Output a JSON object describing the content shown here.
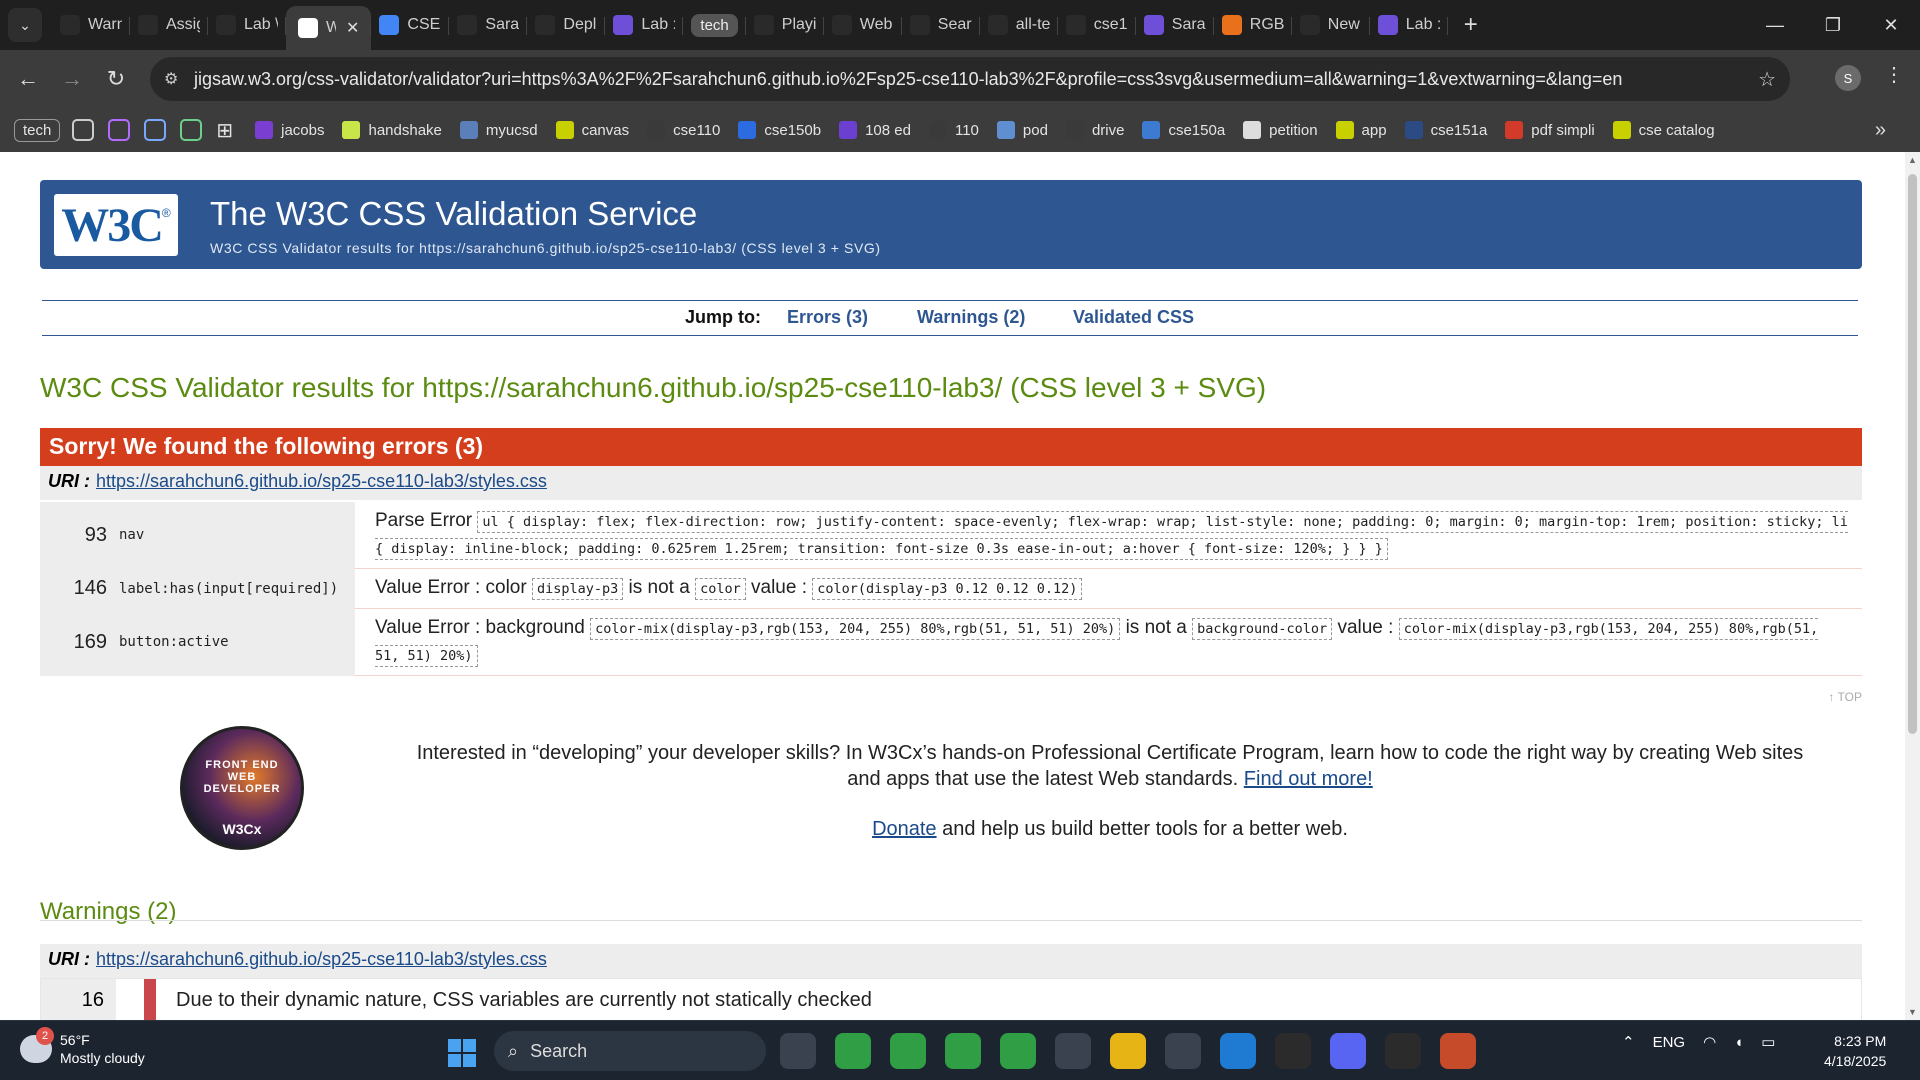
{
  "browser": {
    "tabs": [
      {
        "label": "Warn",
        "icon": "canvas-icon",
        "color": "#2a2a2a"
      },
      {
        "label": "Assig",
        "icon": "canvas-icon",
        "color": "#2a2a2a"
      },
      {
        "label": "Lab \\",
        "icon": "canvas-icon",
        "color": "#2a2a2a"
      },
      {
        "label": "W",
        "icon": "w3c-icon",
        "color": "#ffffff",
        "active": true
      },
      {
        "label": "CSE1",
        "icon": "docs-icon",
        "color": "#4285f4"
      },
      {
        "label": "Sara",
        "icon": "github-icon",
        "color": "#2a2a2a"
      },
      {
        "label": "Depl",
        "icon": "github-icon",
        "color": "#2a2a2a"
      },
      {
        "label": "Lab :",
        "icon": "s-icon",
        "color": "#6d4fd8"
      },
      {
        "label": "tech",
        "icon": "group-pill",
        "color": "#555555",
        "pill": true
      },
      {
        "label": "Playi",
        "icon": "wordpress-icon",
        "color": "#2a2a2a"
      },
      {
        "label": "Web",
        "icon": "webflow-icon",
        "color": "#2a2a2a"
      },
      {
        "label": "Sear",
        "icon": "slack-icon",
        "color": "#2a2a2a"
      },
      {
        "label": "all-te",
        "icon": "slack-icon",
        "color": "#2a2a2a"
      },
      {
        "label": "cse1",
        "icon": "drive-icon",
        "color": "#2a2a2a"
      },
      {
        "label": "Sara",
        "icon": "s-icon",
        "color": "#6d4fd8"
      },
      {
        "label": "RGB",
        "icon": "r-icon",
        "color": "#e9711c"
      },
      {
        "label": "New",
        "icon": "chrome-icon",
        "color": "#2a2a2a"
      },
      {
        "label": "Lab :",
        "icon": "s-icon",
        "color": "#6d4fd8"
      }
    ],
    "url": "jigsaw.w3.org/css-validator/validator?uri=https%3A%2F%2Fsarahchun6.github.io%2Fsp25-cse110-lab3%2F&profile=css3svg&usermedium=all&warning=1&vextwarning=&lang=en",
    "profile_initial": "S",
    "bookmarks": [
      {
        "label": "jacobs",
        "icon": "jacobs-icon",
        "color": "#7a3fd1"
      },
      {
        "label": "handshake",
        "icon": "handshake-icon",
        "color": "#c8e64a"
      },
      {
        "label": "myucsd",
        "icon": "myucsd-icon",
        "color": "#5b7fb8"
      },
      {
        "label": "canvas",
        "icon": "canvas-icon",
        "color": "#c8d000"
      },
      {
        "label": "cse110",
        "icon": "github-icon",
        "color": "#3a3a3a"
      },
      {
        "label": "cse150b",
        "icon": "dropbox-icon",
        "color": "#2c6be0"
      },
      {
        "label": "108 ed",
        "icon": "ed-icon",
        "color": "#6b3fd0"
      },
      {
        "label": "110",
        "icon": "slack-icon",
        "color": "#3a3a3a"
      },
      {
        "label": "pod",
        "icon": "podcast-icon",
        "color": "#5f8fd0"
      },
      {
        "label": "drive",
        "icon": "drive-icon",
        "color": "#3a3a3a"
      },
      {
        "label": "cse150a",
        "icon": "piazza-icon",
        "color": "#3c7bd0"
      },
      {
        "label": "petition",
        "icon": "petition-icon",
        "color": "#dddddd"
      },
      {
        "label": "app",
        "icon": "canvas-icon",
        "color": "#c8d000"
      },
      {
        "label": "cse151a",
        "icon": "ucsd-icon",
        "color": "#2c4b85"
      },
      {
        "label": "pdf simpli",
        "icon": "pdf-icon",
        "color": "#d23a2a"
      },
      {
        "label": "cse catalog",
        "icon": "canvas-icon",
        "color": "#c8d000"
      }
    ],
    "bookmark_group": "tech"
  },
  "page": {
    "logo_text": "W3C",
    "banner_title": "The W3C CSS Validation Service",
    "banner_subtitle": "W3C CSS Validator results for https://sarahchun6.github.io/sp25-cse110-lab3/ (CSS level 3 + SVG)",
    "jump_label": "Jump to:",
    "jump_errors": "Errors (3)",
    "jump_warnings": "Warnings (2)",
    "jump_validated": "Validated CSS",
    "results_title": "W3C CSS Validator results for https://sarahchun6.github.io/sp25-cse110-lab3/ (CSS level 3 + SVG)",
    "errors_heading": "Sorry! We found the following errors (3)",
    "uri_label": "URI :",
    "uri": "https://sarahchun6.github.io/sp25-cse110-lab3/styles.css",
    "errors": [
      {
        "line": "93",
        "context": "nav",
        "type": "Parse Error",
        "code": "ul { display: flex; flex-direction: row; justify-content: space-evenly; flex-wrap: wrap; list-style: none; padding: 0; margin: 0; margin-top: 1rem; position: sticky; li { display: inline-block; padding: 0.625rem 1.25rem; transition: font-size 0.3s ease-in-out; a:hover { font-size: 120%; } } }"
      },
      {
        "line": "146",
        "context": "label:has(input[required])",
        "type": "Value Error : color",
        "value": "display-p3",
        "mid": "is not a",
        "prop": "color",
        "tail": "value :",
        "full": "color(display-p3 0.12 0.12 0.12)"
      },
      {
        "line": "169",
        "context": "button:active",
        "type": "Value Error : background",
        "value": "color-mix(display-p3,rgb(153, 204, 255) 80%,rgb(51, 51, 51) 20%)",
        "mid": "is not a",
        "prop": "background-color",
        "tail": "value :",
        "full": "color-mix(display-p3,rgb(153, 204, 255) 80%,rgb(51, 51, 51) 20%)"
      }
    ],
    "top_link": "↑ TOP",
    "promo_text": "Interested in “developing” your developer skills? In W3Cx’s hands-on Professional Certificate Program, learn how to code the right way by creating Web sites and apps that use the latest Web standards.",
    "promo_link": "Find out more!",
    "badge_text": "FRONT END WEB DEVELOPER",
    "badge_brand": "W3Cx",
    "donate_link": "Donate",
    "donate_text": "and help us build better tools for a better web.",
    "warnings_title": "Warnings (2)",
    "warning_line": "16",
    "warning_msg": "Due to their dynamic nature, CSS variables are currently not statically checked"
  },
  "taskbar": {
    "temp": "56°F",
    "weather": "Mostly cloudy",
    "weather_badge": "2",
    "search_placeholder": "Search",
    "lang": "ENG",
    "time": "8:23 PM",
    "date": "4/18/2025",
    "apps": [
      {
        "name": "task-view-icon",
        "color": "#3a4250"
      },
      {
        "name": "chrome-icon",
        "color": "#2f9e44"
      },
      {
        "name": "chrome-profile-icon",
        "color": "#2f9e44"
      },
      {
        "name": "chrome-alt-icon",
        "color": "#2f9e44"
      },
      {
        "name": "chrome-third-icon",
        "color": "#2f9e44"
      },
      {
        "name": "audio-icon",
        "color": "#3a4250"
      },
      {
        "name": "file-explorer-icon",
        "color": "#e7b416"
      },
      {
        "name": "3d-viewer-icon",
        "color": "#3a4250"
      },
      {
        "name": "vscode-icon",
        "color": "#1f7ad1"
      },
      {
        "name": "terminal-icon",
        "color": "#2b2b2b"
      },
      {
        "name": "discord-icon",
        "color": "#5865f2"
      },
      {
        "name": "cmd-icon",
        "color": "#2b2b2b"
      },
      {
        "name": "git-icon",
        "color": "#c54b2a"
      }
    ]
  }
}
